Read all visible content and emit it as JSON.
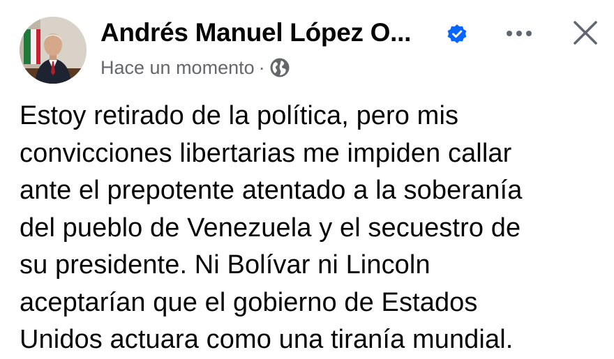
{
  "post": {
    "author": {
      "name": "Andrés Manuel López O...",
      "verified": true,
      "avatar_icon": "person-photo"
    },
    "timestamp": "Hace un momento",
    "separator": "·",
    "audience_icon": "globe-icon",
    "actions": {
      "more_icon": "more-options-icon",
      "close_icon": "close-icon"
    },
    "text_lines": [
      "Estoy retirado de la política, pero mis",
      "convicciones libertarias me impiden callar",
      "ante el prepotente atentado a la soberanía",
      "del pueblo de Venezuela y el secuestro de",
      "su presidente. Ni Bolívar ni Lincoln",
      "aceptarían que el gobierno de Estados",
      "Unidos actuara como una tiranía mundial."
    ]
  },
  "colors": {
    "verified_blue": "#0866ff",
    "meta_gray": "#65676b",
    "text": "#050505",
    "icon_gray": "#606770"
  }
}
